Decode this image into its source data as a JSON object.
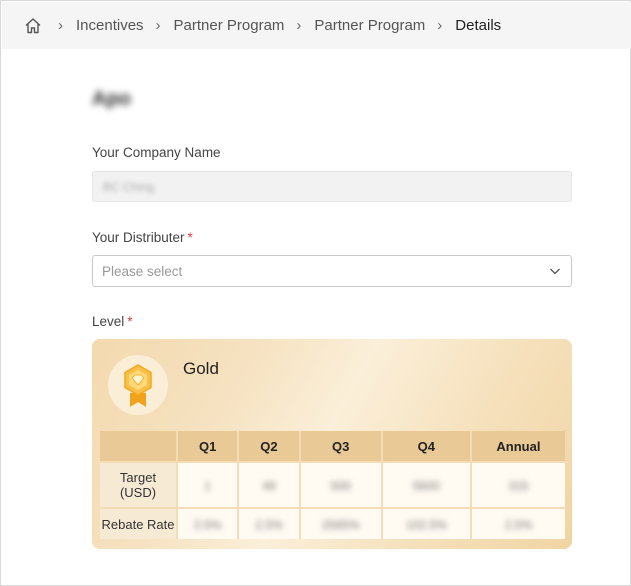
{
  "breadcrumb": {
    "items": [
      "Incentives",
      "Partner Program",
      "Partner Program"
    ],
    "current": "Details"
  },
  "page_title": "Apo",
  "form": {
    "company_label": "Your Company Name",
    "company_value": "BC Ching",
    "distributer_label": "Your Distributer",
    "distributer_placeholder": "Please select",
    "level_label": "Level",
    "required_mark": "*"
  },
  "level_card": {
    "name": "Gold",
    "columns": [
      "Q1",
      "Q2",
      "Q3",
      "Q4",
      "Annual"
    ],
    "rows": [
      {
        "label_line1": "Target",
        "label_line2": "(USD)",
        "values": [
          "1",
          "49",
          "500",
          "5600",
          "315"
        ]
      },
      {
        "label_line1": "Rebate Rate",
        "label_line2": "",
        "values": [
          "2.5%",
          "2.5%",
          "2565%",
          "102.5%",
          "2.5%"
        ]
      }
    ]
  },
  "colors": {
    "required": "#e4393c",
    "card_gold": "#f3d9ae",
    "medal_gold": "#f5b632"
  },
  "icons": {
    "home": "home-icon",
    "separator": "chevron-right-icon",
    "dropdown": "chevron-down-icon",
    "medal": "gold-medal-icon"
  }
}
